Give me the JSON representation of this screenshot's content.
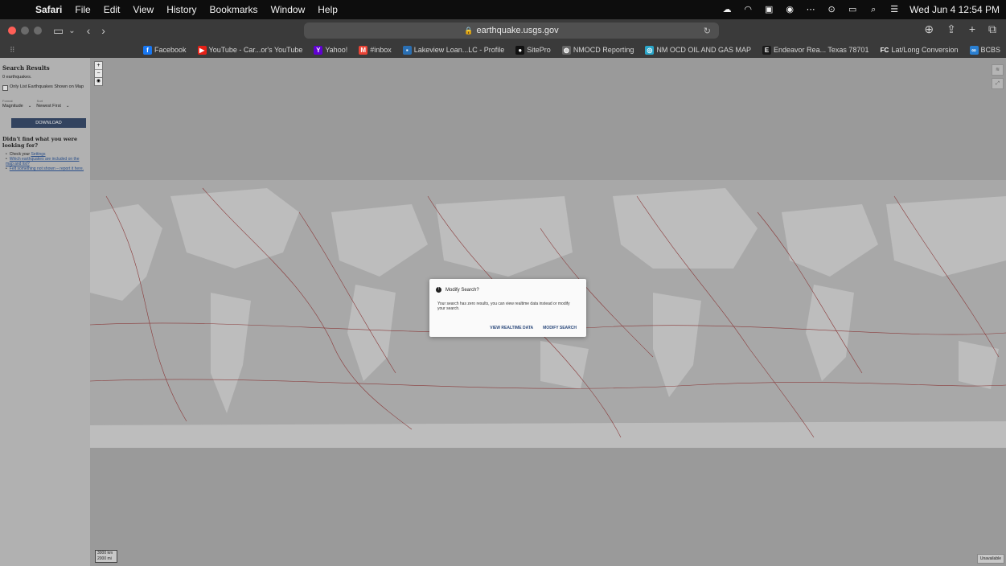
{
  "menubar": {
    "items": [
      "Safari",
      "File",
      "Edit",
      "View",
      "History",
      "Bookmarks",
      "Window",
      "Help"
    ],
    "clock": "Wed Jun 4  12:54 PM"
  },
  "browser": {
    "url": "earthquake.usgs.gov",
    "favorites": [
      {
        "label": "Facebook",
        "icon": "facebook-icon",
        "color": "#1877f2",
        "glyph": "f"
      },
      {
        "label": "YouTube - Car...or's YouTube",
        "icon": "youtube-icon",
        "color": "#e62117",
        "glyph": "▶"
      },
      {
        "label": "Yahoo!",
        "icon": "yahoo-icon",
        "color": "#6001d2",
        "glyph": "Y"
      },
      {
        "label": "#inbox",
        "icon": "gmail-icon",
        "color": "#ea4335",
        "glyph": "M"
      },
      {
        "label": "Lakeview Loan...LC - Profile",
        "icon": "lakeview-icon",
        "color": "#2a6fb3",
        "glyph": "▪"
      },
      {
        "label": "SitePro",
        "icon": "sitepro-icon",
        "color": "#111111",
        "glyph": "●"
      },
      {
        "label": "NMOCD Reporting",
        "icon": "nmocd-icon",
        "color": "#666666",
        "glyph": "◍"
      },
      {
        "label": "NM OCD OIL AND GAS MAP",
        "icon": "nm-map-icon",
        "color": "#2aa6c9",
        "glyph": "◎"
      },
      {
        "label": "Endeavor Rea... Texas 78701",
        "icon": "endeavor-icon",
        "color": "#1b1b1b",
        "glyph": "E"
      },
      {
        "label": "Lat/Long Conversion",
        "icon": "fcc-icon",
        "color": "#3a3a3a",
        "glyph": "FC"
      },
      {
        "label": "BCBS",
        "icon": "bcbs-icon",
        "color": "#2a7fd1",
        "glyph": "∞"
      }
    ]
  },
  "sidebar": {
    "title": "Search Results",
    "count": "0 earthquakes.",
    "only_list": "Only List Earthquakes Shown on Map",
    "format_label": "Format",
    "sort_label": "Sort",
    "format_value": "Magnitude",
    "sort_value": "Newest First",
    "download": "DOWNLOAD",
    "help_title": "Didn't find what you were looking for?",
    "help_links": [
      {
        "prefix": "Check your ",
        "link": "Settings"
      },
      {
        "prefix": "",
        "link": "Which earthquakes are included on the map and list?"
      },
      {
        "prefix": "",
        "link": "Felt something not shown – report it here."
      }
    ]
  },
  "map": {
    "scale_km": "3000 km",
    "scale_mi": "2000 mi",
    "attribution": "Unavailable"
  },
  "modal": {
    "title": "Modify Search?",
    "body": "Your search has zero results, you can view realtime data instead or modify your search.",
    "view_realtime": "VIEW REALTIME DATA",
    "modify_search": "MODIFY SEARCH"
  }
}
